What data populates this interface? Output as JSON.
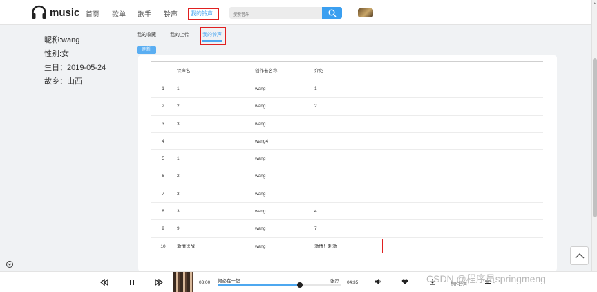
{
  "header": {
    "logo_text": "music",
    "nav": [
      "首页",
      "歌单",
      "歌手",
      "铃声",
      "我的铃声"
    ],
    "search_placeholder": "搜索音乐"
  },
  "profile": {
    "nickname": "昵称:wang",
    "gender": "性别:女",
    "birthday": "生日：2019-05-24",
    "hometown": "故乡：山西"
  },
  "tabs": [
    "我的收藏",
    "我的上传",
    "我的铃声"
  ],
  "refresh_label": "刷新",
  "table": {
    "columns": [
      "铃声名",
      "创作者名称",
      "介绍"
    ],
    "rows": [
      {
        "idx": "1",
        "name": "1",
        "creator": "wang",
        "intro": "1"
      },
      {
        "idx": "2",
        "name": "2",
        "creator": "wang",
        "intro": "2"
      },
      {
        "idx": "3",
        "name": "3",
        "creator": "wang",
        "intro": ""
      },
      {
        "idx": "4",
        "name": "",
        "creator": "wang4",
        "intro": ""
      },
      {
        "idx": "5",
        "name": "1",
        "creator": "wang",
        "intro": ""
      },
      {
        "idx": "6",
        "name": "2",
        "creator": "wang",
        "intro": ""
      },
      {
        "idx": "7",
        "name": "3",
        "creator": "wang",
        "intro": ""
      },
      {
        "idx": "8",
        "name": "3",
        "creator": "wang",
        "intro": "4"
      },
      {
        "idx": "9",
        "name": "9",
        "creator": "wang",
        "intro": "7"
      },
      {
        "idx": "10",
        "name": "激情送战",
        "creator": "wang",
        "intro": "激情！刺激"
      }
    ]
  },
  "player": {
    "current_time": "03:00",
    "total_time": "04:35",
    "song_title": "何必在一起",
    "artist": "张杰",
    "progress_fraction": 0.67,
    "lyric_label": "制作铃声"
  },
  "watermark": "CSDN @程序员springmeng",
  "colors": {
    "accent": "#4ea8f0",
    "highlight": "#e02020"
  }
}
